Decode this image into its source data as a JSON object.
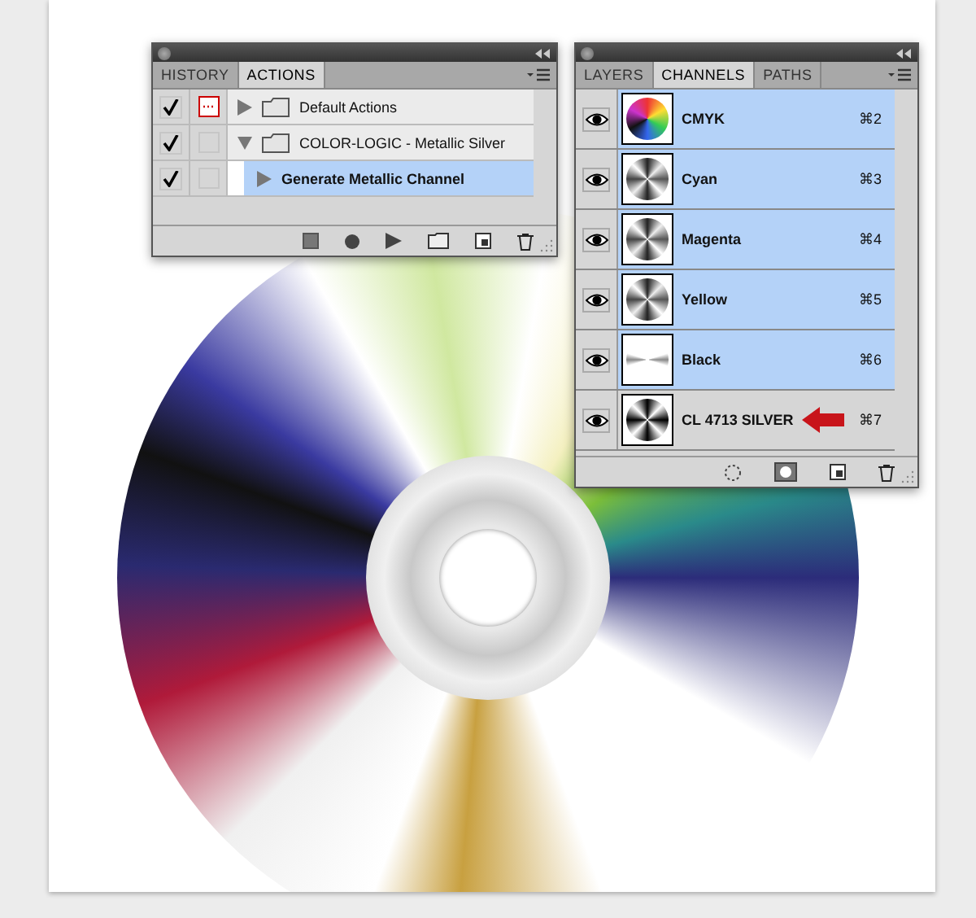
{
  "actions_panel": {
    "tabs": [
      {
        "label": "HISTORY",
        "selected": false
      },
      {
        "label": "ACTIONS",
        "selected": true
      }
    ],
    "rows": [
      {
        "name": "Default Actions",
        "checked": true,
        "dialog": true,
        "expanded": false,
        "selected": false
      },
      {
        "name": "COLOR-LOGIC - Metallic Silver",
        "checked": true,
        "dialog": false,
        "expanded": true,
        "selected": false,
        "children": [
          {
            "name": "Generate Metallic Channel",
            "checked": true,
            "dialog": false,
            "expanded": false,
            "selected": true
          }
        ]
      }
    ]
  },
  "channels_panel": {
    "tabs": [
      {
        "label": "LAYERS",
        "selected": false
      },
      {
        "label": "CHANNELS",
        "selected": true
      },
      {
        "label": "PATHS",
        "selected": false
      }
    ],
    "rows": [
      {
        "name": "CMYK",
        "shortcut": "⌘2",
        "visible": true,
        "selected": true,
        "kind": "color",
        "arrow": false
      },
      {
        "name": "Cyan",
        "shortcut": "⌘3",
        "visible": true,
        "selected": true,
        "kind": "gray",
        "arrow": false
      },
      {
        "name": "Magenta",
        "shortcut": "⌘4",
        "visible": true,
        "selected": true,
        "kind": "gray",
        "arrow": false
      },
      {
        "name": "Yellow",
        "shortcut": "⌘5",
        "visible": true,
        "selected": true,
        "kind": "gray",
        "arrow": false
      },
      {
        "name": "Black",
        "shortcut": "⌘6",
        "visible": true,
        "selected": true,
        "kind": "light",
        "arrow": false
      },
      {
        "name": "CL 4713 SILVER",
        "shortcut": "⌘7",
        "visible": true,
        "selected": false,
        "kind": "dark",
        "arrow": true
      }
    ]
  }
}
